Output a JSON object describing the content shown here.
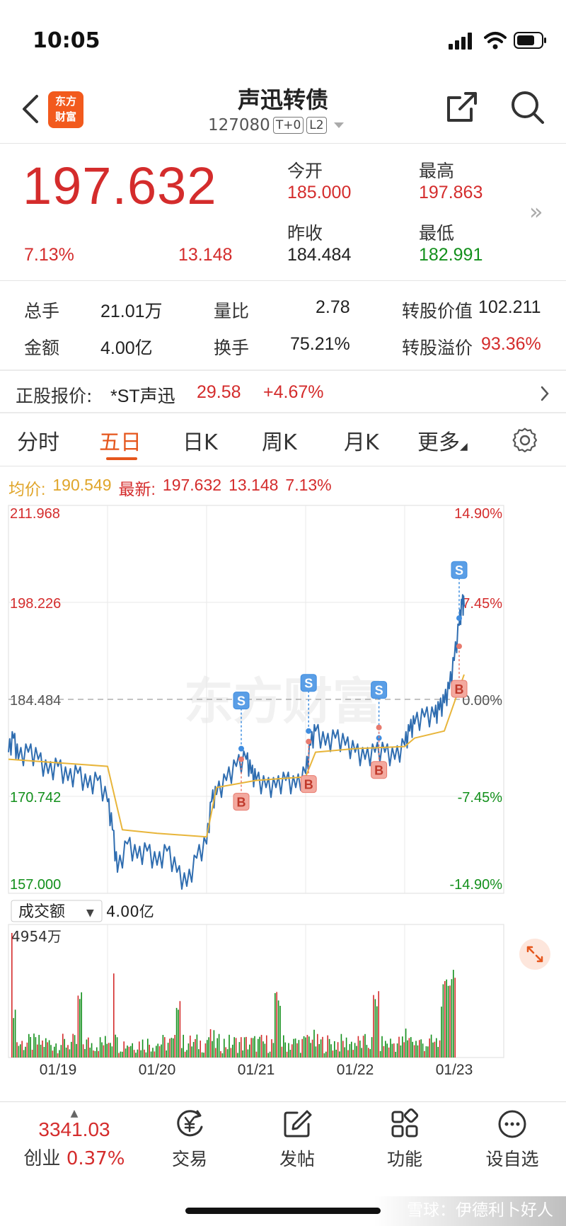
{
  "status_bar": {
    "time": "10:05"
  },
  "header": {
    "logo_line1": "东方",
    "logo_line2": "财富",
    "title": "声迅转债",
    "code": "127080",
    "tag_t0": "T+0",
    "tag_l2": "L2"
  },
  "quote": {
    "price": "197.632",
    "change_pct": "7.13%",
    "change": "13.148",
    "open_label": "今开",
    "open": "185.000",
    "high_label": "最高",
    "high": "197.863",
    "prev_close_label": "昨收",
    "prev_close": "184.484",
    "low_label": "最低",
    "low": "182.991"
  },
  "stats": {
    "volume_label": "总手",
    "volume": "21.01万",
    "vol_ratio_label": "量比",
    "vol_ratio": "2.78",
    "conv_value_label": "转股价值",
    "conv_value": "102.211",
    "amount_label": "金额",
    "amount": "4.00亿",
    "turnover_label": "换手",
    "turnover": "75.21%",
    "conv_premium_label": "转股溢价",
    "conv_premium": "93.36%"
  },
  "underlying": {
    "label": "正股报价:",
    "name": "*ST声迅",
    "price": "29.58",
    "change_pct": "+4.67%"
  },
  "tabs": [
    {
      "label": "分时"
    },
    {
      "label": "五日"
    },
    {
      "label": "日K"
    },
    {
      "label": "周K"
    },
    {
      "label": "月K"
    },
    {
      "label": "更多"
    }
  ],
  "legend": {
    "avg_label": "均价:",
    "avg_value": "190.549",
    "latest_label": "最新:",
    "latest_value": "197.632",
    "latest_change": "13.148",
    "latest_pct": "7.13%"
  },
  "chart_data": {
    "type": "line",
    "y_labels_left": [
      "211.968",
      "198.226",
      "184.484",
      "170.742",
      "157.000"
    ],
    "y_labels_right": [
      "14.90%",
      "7.45%",
      "0.00%",
      "-7.45%",
      "-14.90%"
    ],
    "ylim": [
      157.0,
      211.968
    ],
    "baseline": 184.484,
    "dates": [
      "01/19",
      "01/20",
      "01/21",
      "01/22",
      "01/23"
    ],
    "volume_selector": "成交额",
    "volume_total": "4.00亿",
    "volume_max_label": "4954万",
    "watermark_text": "东方财富",
    "series": [
      {
        "name": "",
        "color": "#2f6db0",
        "points": [
          [
            0,
            177
          ],
          [
            0.05,
            179
          ],
          [
            0.1,
            176
          ],
          [
            0.2,
            177
          ],
          [
            0.3,
            176
          ],
          [
            0.4,
            174
          ],
          [
            0.5,
            175
          ],
          [
            0.6,
            173
          ],
          [
            0.7,
            174
          ],
          [
            0.8,
            172
          ],
          [
            0.9,
            173
          ],
          [
            1.0,
            170
          ],
          [
            1.05,
            166
          ],
          [
            1.1,
            160
          ],
          [
            1.2,
            164
          ],
          [
            1.3,
            162
          ],
          [
            1.4,
            163
          ],
          [
            1.5,
            161
          ],
          [
            1.6,
            163
          ],
          [
            1.7,
            160
          ],
          [
            1.8,
            158
          ],
          [
            1.9,
            162
          ],
          [
            2.0,
            164
          ],
          [
            2.05,
            170
          ],
          [
            2.1,
            171
          ],
          [
            2.2,
            173
          ],
          [
            2.3,
            175
          ],
          [
            2.4,
            176
          ],
          [
            2.45,
            174
          ],
          [
            2.5,
            173
          ],
          [
            2.6,
            172
          ],
          [
            2.7,
            172
          ],
          [
            2.8,
            173
          ],
          [
            2.9,
            172
          ],
          [
            3.0,
            174
          ],
          [
            3.05,
            178
          ],
          [
            3.1,
            180
          ],
          [
            3.2,
            178
          ],
          [
            3.3,
            179
          ],
          [
            3.4,
            178
          ],
          [
            3.5,
            177
          ],
          [
            3.6,
            176
          ],
          [
            3.7,
            177
          ],
          [
            3.8,
            177
          ],
          [
            3.9,
            176
          ],
          [
            4.0,
            178
          ],
          [
            4.05,
            180
          ],
          [
            4.1,
            181
          ],
          [
            4.2,
            182
          ],
          [
            4.3,
            182
          ],
          [
            4.35,
            183
          ],
          [
            4.4,
            184
          ],
          [
            4.45,
            186
          ],
          [
            4.5,
            190
          ],
          [
            4.55,
            195
          ],
          [
            4.58,
            198
          ],
          [
            4.6,
            197.632
          ]
        ]
      },
      {
        "name": "",
        "color": "#e8b53a",
        "points": [
          [
            0,
            176
          ],
          [
            0.5,
            175.5
          ],
          [
            1.0,
            175
          ],
          [
            1.15,
            166
          ],
          [
            1.5,
            165.5
          ],
          [
            2.0,
            165
          ],
          [
            2.1,
            172
          ],
          [
            2.5,
            173
          ],
          [
            3.0,
            173.5
          ],
          [
            3.1,
            177
          ],
          [
            3.5,
            177.5
          ],
          [
            4.0,
            177.8
          ],
          [
            4.1,
            179
          ],
          [
            4.4,
            180
          ],
          [
            4.5,
            184
          ],
          [
            4.6,
            188
          ]
        ]
      }
    ],
    "markers": [
      {
        "type": "S",
        "x": 2.35,
        "y": 177.5
      },
      {
        "type": "B",
        "x": 2.35,
        "y": 176
      },
      {
        "type": "S",
        "x": 3.03,
        "y": 180
      },
      {
        "type": "B",
        "x": 3.03,
        "y": 178.5
      },
      {
        "type": "S",
        "x": 3.74,
        "y": 179
      },
      {
        "type": "B",
        "x": 3.74,
        "y": 180.5
      },
      {
        "type": "S",
        "x": 4.55,
        "y": 196
      },
      {
        "type": "B",
        "x": 4.55,
        "y": 192
      }
    ]
  },
  "bottom_nav": {
    "index_value": "3341.03",
    "index_name": "创业",
    "index_pct": "0.37%",
    "trade_label": "交易",
    "post_label": "发帖",
    "function_label": "功能",
    "watchlist_label": "设自选"
  },
  "footer": {
    "watermark": "雪球：伊德利卜好人"
  }
}
